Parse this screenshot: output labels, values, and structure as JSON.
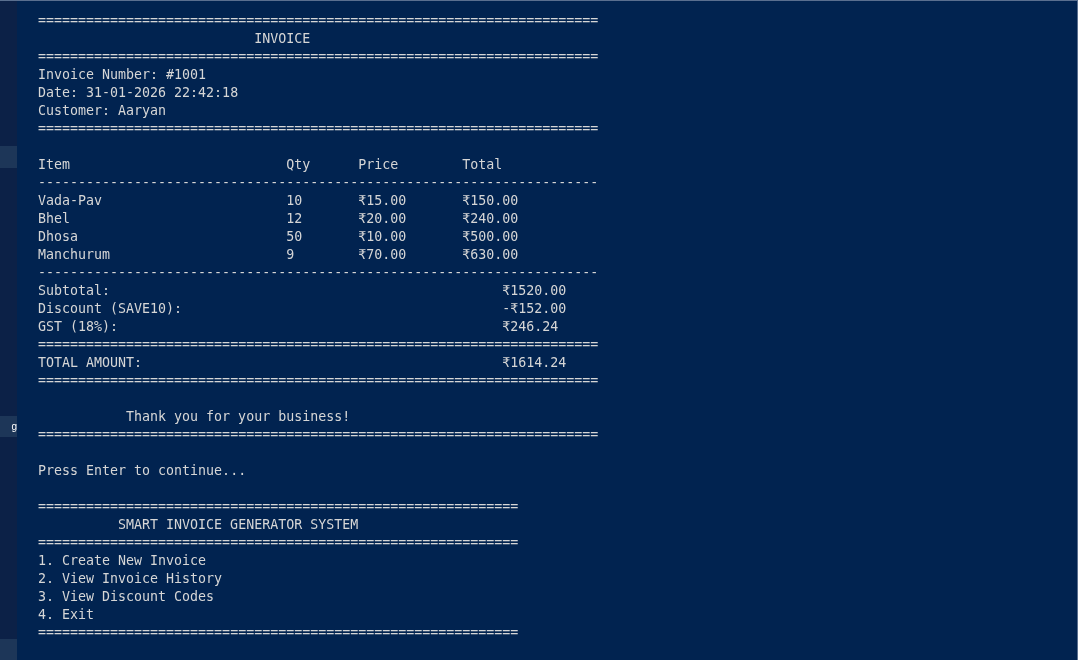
{
  "side_panel": {
    "label": "g"
  },
  "lines": [
    {
      "kind": "rule",
      "text": "======================================================================"
    },
    {
      "kind": "heading",
      "text": "INVOICE"
    },
    {
      "kind": "rule",
      "text": "======================================================================"
    },
    {
      "kind": "text",
      "text": "Invoice Number: #1001"
    },
    {
      "kind": "text",
      "text": "Date: 31-01-2026 22:42:18"
    },
    {
      "kind": "text",
      "text": "Customer: Aaryan"
    },
    {
      "kind": "rule",
      "text": "======================================================================"
    },
    {
      "kind": "blank"
    },
    {
      "kind": "row",
      "cells": [
        "Item",
        "Qty",
        "Price",
        "Total"
      ]
    },
    {
      "kind": "rule",
      "text": "----------------------------------------------------------------------"
    },
    {
      "kind": "row",
      "cells": [
        "Vada-Pav",
        "10",
        "₹15.00",
        "₹150.00"
      ]
    },
    {
      "kind": "row",
      "cells": [
        "Bhel",
        "12",
        "₹20.00",
        "₹240.00"
      ]
    },
    {
      "kind": "row",
      "cells": [
        "Dhosa",
        "50",
        "₹10.00",
        "₹500.00"
      ]
    },
    {
      "kind": "row",
      "cells": [
        "Manchurum",
        "9",
        "₹70.00",
        "₹630.00"
      ]
    },
    {
      "kind": "rule",
      "text": "----------------------------------------------------------------------"
    },
    {
      "kind": "summary",
      "label": "Subtotal:",
      "value": "₹1520.00"
    },
    {
      "kind": "summary",
      "label": "Discount (SAVE10):",
      "value": "-₹152.00"
    },
    {
      "kind": "summary",
      "label": "GST (18%):",
      "value": "₹246.24"
    },
    {
      "kind": "rule",
      "text": "======================================================================"
    },
    {
      "kind": "summary",
      "label": "TOTAL AMOUNT:",
      "value": "₹1614.24"
    },
    {
      "kind": "rule",
      "text": "======================================================================"
    },
    {
      "kind": "blank"
    },
    {
      "kind": "closing",
      "text": "Thank you for your business!"
    },
    {
      "kind": "rule",
      "text": "======================================================================"
    },
    {
      "kind": "blank"
    },
    {
      "kind": "text",
      "text": "Press Enter to continue..."
    },
    {
      "kind": "blank"
    },
    {
      "kind": "rule",
      "text": "============================================================"
    },
    {
      "kind": "banner",
      "text": "SMART INVOICE GENERATOR SYSTEM"
    },
    {
      "kind": "rule",
      "text": "============================================================"
    },
    {
      "kind": "text",
      "text": "1. Create New Invoice"
    },
    {
      "kind": "text",
      "text": "2. View Invoice History"
    },
    {
      "kind": "text",
      "text": "3. View Discount Codes"
    },
    {
      "kind": "text",
      "text": "4. Exit"
    },
    {
      "kind": "rule",
      "text": "============================================================"
    }
  ]
}
